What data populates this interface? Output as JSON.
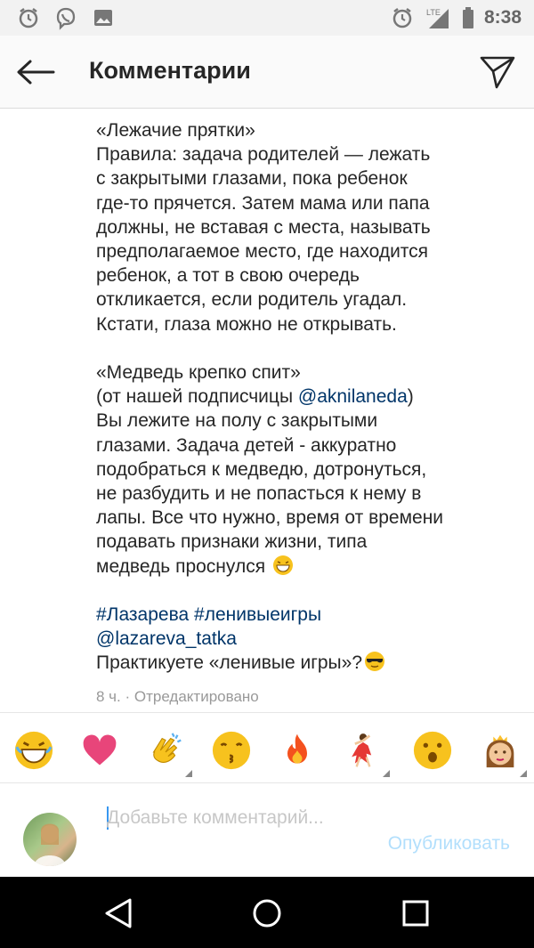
{
  "status_bar": {
    "time": "8:38",
    "network": "LTE",
    "left_icons": [
      "alarm-icon",
      "viber-icon",
      "gallery-icon"
    ],
    "right_icons": [
      "alarm-icon",
      "signal-icon",
      "battery-icon"
    ]
  },
  "header": {
    "title": "Комментарии",
    "back_icon": "arrow-left-icon",
    "send_icon": "direct-send-icon"
  },
  "caption": {
    "game1": {
      "title": "«Лежачие прятки»",
      "rules": [
        "Правила: задача родителей — лежать",
        "с закрытыми глазами, пока ребенок",
        "где-то прячется. Затем мама или папа",
        "должны, не вставая с места, называть",
        "предполагаемое место, где находится",
        "ребенок, а тот в свою очередь",
        "откликается, если родитель угадал.",
        "Кстати, глаза можно не открывать."
      ]
    },
    "game2": {
      "title": "«Медведь крепко спит»",
      "from_prefix": "(от нашей подписчицы ",
      "from_mention": "@aknilaneda",
      "from_suffix": ")",
      "body": [
        "Вы лежите на полу с закрытыми",
        "глазами. Задача детей - аккуратно",
        "подобраться к медведю, дотронуться,",
        "не разбудить и не попасться к нему в",
        "лапы. Все что нужно, время от времени",
        "подавать признаки жизни, типа"
      ],
      "last_line": "медведь проснулся"
    },
    "tags": {
      "hashtag1": "#Лазарева",
      "hashtag2": "#ленивыеигры",
      "mention": "@lazareva_tatka"
    },
    "question": "Практикуете «ленивые игры»?",
    "meta": "8 ч. · Отредактировано"
  },
  "emoji_bar": {
    "items": [
      "grinning-face-icon",
      "heart-icon",
      "clapping-hands-icon",
      "kissing-face-icon",
      "fire-icon",
      "dancer-icon",
      "surprised-face-icon",
      "princess-icon"
    ]
  },
  "composer": {
    "placeholder": "Добавьте комментарий...",
    "publish_label": "Опубликовать"
  },
  "colors": {
    "link": "#003569",
    "meta": "#999999",
    "publish_disabled": "#b2dffc",
    "caret": "#3897f0"
  }
}
